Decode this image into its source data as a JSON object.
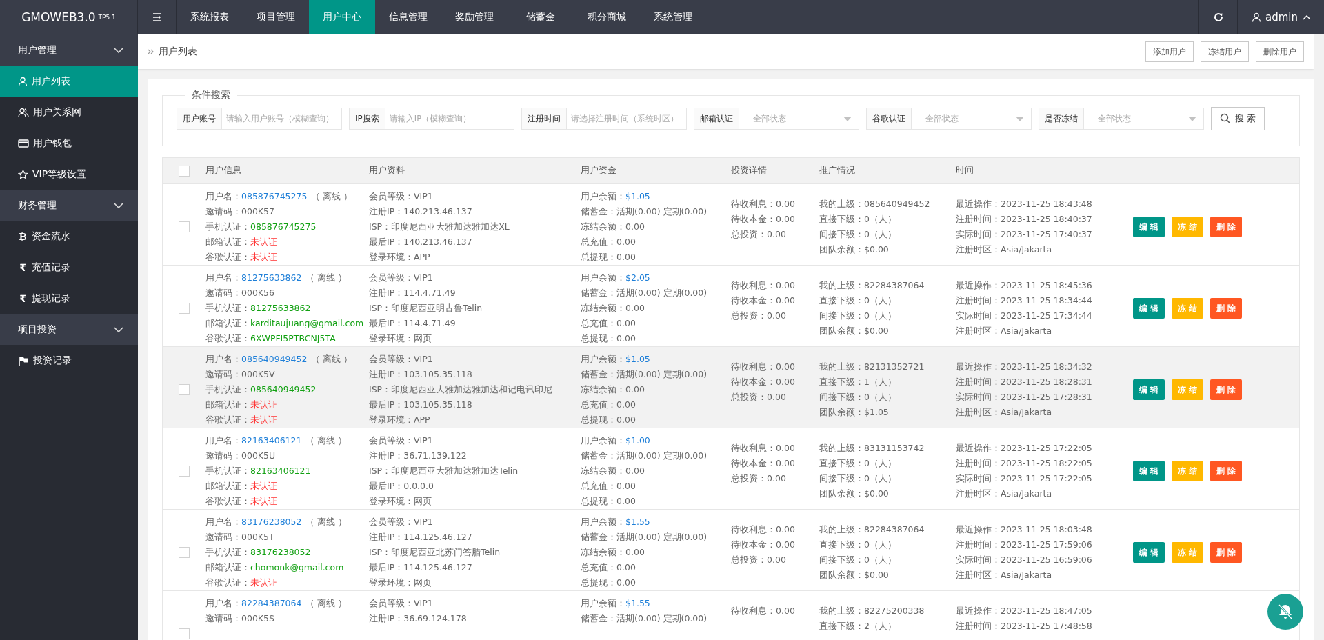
{
  "brand": {
    "name": "GMOWEB3.0",
    "version": "TP5.1"
  },
  "top_nav": [
    {
      "label": "系统报表",
      "selected": false
    },
    {
      "label": "项目管理",
      "selected": false
    },
    {
      "label": "用户中心",
      "selected": true
    },
    {
      "label": "信息管理",
      "selected": false
    },
    {
      "label": "奖励管理",
      "selected": false
    },
    {
      "label": "储蓄金",
      "selected": false
    },
    {
      "label": "积分商城",
      "selected": false
    },
    {
      "label": "系统管理",
      "selected": false
    }
  ],
  "user_menu": {
    "label": "admin",
    "expanded": true
  },
  "sidebar": [
    {
      "label": "用户管理",
      "expanded": true,
      "children": [
        {
          "label": "用户列表",
          "selected": true
        },
        {
          "label": "用户关系网",
          "selected": false
        },
        {
          "label": "用户钱包",
          "selected": false
        },
        {
          "label": "VIP等级设置",
          "selected": false
        }
      ]
    },
    {
      "label": "财务管理",
      "expanded": true,
      "children": [
        {
          "label": "资金流水",
          "selected": false,
          "glyph": "₿"
        },
        {
          "label": "充值记录",
          "selected": false,
          "glyph": "₹"
        },
        {
          "label": "提现记录",
          "selected": false,
          "glyph": "₹"
        }
      ]
    },
    {
      "label": "项目投资",
      "expanded": true,
      "children": [
        {
          "label": "投资记录",
          "selected": false
        }
      ]
    }
  ],
  "breadcrumb": "用户列表",
  "header_buttons": [
    "添加用户",
    "冻结用户",
    "删除用户"
  ],
  "search": {
    "legend": "条件搜索",
    "filters": [
      {
        "label": "用户账号",
        "kind": "input",
        "placeholder": "请输入用户账号（模糊查询）"
      },
      {
        "label": "IP搜索",
        "kind": "input",
        "placeholder": "请输入IP（模糊查询）"
      },
      {
        "label": "注册时间",
        "kind": "input",
        "placeholder": "请选择注册时间（系统时区）"
      },
      {
        "label": "邮箱认证",
        "kind": "select",
        "placeholder": "-- 全部状态 --"
      },
      {
        "label": "谷歌认证",
        "kind": "select",
        "placeholder": "-- 全部状态 --"
      },
      {
        "label": "是否冻结",
        "kind": "select",
        "placeholder": "-- 全部状态 --"
      }
    ],
    "button": "搜 索"
  },
  "table": {
    "select_all": false,
    "columns": [
      "用户信息",
      "用户资料",
      "用户资金",
      "投资详情",
      "推广情况",
      "时间"
    ],
    "rows": [
      {
        "selected": false,
        "highlighted": false,
        "cells": [
          [
            {
              "label": "用户名：",
              "value": "085876745275",
              "color": "#1e7fd8",
              "suffix": "（ 离线 ）"
            },
            {
              "label": "邀请码：",
              "value": "000K57"
            },
            {
              "label": "手机认证：",
              "value": "085876745275",
              "color": "#12a012"
            },
            {
              "label": "邮箱认证：",
              "value": "未认证",
              "color": "#ff3333"
            },
            {
              "label": "谷歌认证：",
              "value": "未认证",
              "color": "#ff3333"
            }
          ],
          [
            {
              "label": "会员等级：",
              "value": "VIP1"
            },
            {
              "label": "注册IP：",
              "value": "140.213.46.137"
            },
            {
              "label": "ISP：",
              "value": "印度尼西亚大雅加达雅加达XL"
            },
            {
              "label": "最后IP：",
              "value": "140.213.46.137"
            },
            {
              "label": "登录环境：",
              "value": "APP"
            }
          ],
          [
            {
              "label": "用户余额：",
              "value": "$1.05",
              "color": "#1e7fd8"
            },
            {
              "label": "储蓄金：",
              "value": "活期(0.00) 定期(0.00)"
            },
            {
              "label": "冻结余额：",
              "value": "0.00"
            },
            {
              "label": "总充值：",
              "value": "0.00"
            },
            {
              "label": "总提现：",
              "value": "0.00"
            }
          ],
          [
            {
              "label": "待收利息：",
              "value": "0.00"
            },
            {
              "label": "待收本金：",
              "value": "0.00"
            },
            {
              "label": "总投资：",
              "value": "0.00"
            }
          ],
          [
            {
              "label": "我的上级：",
              "value": "085640949452"
            },
            {
              "label": "直接下级：",
              "value": "0（人）"
            },
            {
              "label": "间接下级：",
              "value": "0（人）"
            },
            {
              "label": "团队余额：",
              "value": "$0.00"
            }
          ],
          [
            {
              "label": "最近操作：",
              "value": "2023-11-25 18:43:48"
            },
            {
              "label": "注册时间：",
              "value": "2023-11-25 18:40:37"
            },
            {
              "label": "实际时间：",
              "value": "2023-11-25 17:40:37"
            },
            {
              "label": "注册时区：",
              "value": "Asia/Jakarta"
            }
          ]
        ],
        "actions": [
          {
            "label": "编 辑",
            "kind": "edit"
          },
          {
            "label": "冻 结",
            "kind": "freeze"
          },
          {
            "label": "删 除",
            "kind": "delete"
          }
        ]
      },
      {
        "selected": false,
        "highlighted": false,
        "cells": [
          [
            {
              "label": "用户名：",
              "value": "81275633862",
              "color": "#1e7fd8",
              "suffix": "（ 离线 ）"
            },
            {
              "label": "邀请码：",
              "value": "000K56"
            },
            {
              "label": "手机认证：",
              "value": "81275633862",
              "color": "#12a012"
            },
            {
              "label": "邮箱认证：",
              "value": "karditaujuang@gmail.com",
              "color": "#12a012"
            },
            {
              "label": "谷歌认证：",
              "value": "6XWPFI5PTBCNJ5TA",
              "color": "#12a012"
            }
          ],
          [
            {
              "label": "会员等级：",
              "value": "VIP1"
            },
            {
              "label": "注册IP：",
              "value": "114.4.71.49"
            },
            {
              "label": "ISP：",
              "value": "印度尼西亚明古鲁Telin"
            },
            {
              "label": "最后IP：",
              "value": "114.4.71.49"
            },
            {
              "label": "登录环境：",
              "value": "网页"
            }
          ],
          [
            {
              "label": "用户余额：",
              "value": "$2.05",
              "color": "#1e7fd8"
            },
            {
              "label": "储蓄金：",
              "value": "活期(0.00) 定期(0.00)"
            },
            {
              "label": "冻结余额：",
              "value": "0.00"
            },
            {
              "label": "总充值：",
              "value": "0.00"
            },
            {
              "label": "总提现：",
              "value": "0.00"
            }
          ],
          [
            {
              "label": "待收利息：",
              "value": "0.00"
            },
            {
              "label": "待收本金：",
              "value": "0.00"
            },
            {
              "label": "总投资：",
              "value": "0.00"
            }
          ],
          [
            {
              "label": "我的上级：",
              "value": "82284387064"
            },
            {
              "label": "直接下级：",
              "value": "0（人）"
            },
            {
              "label": "间接下级：",
              "value": "0（人）"
            },
            {
              "label": "团队余额：",
              "value": "$0.00"
            }
          ],
          [
            {
              "label": "最近操作：",
              "value": "2023-11-25 18:45:36"
            },
            {
              "label": "注册时间：",
              "value": "2023-11-25 18:34:44"
            },
            {
              "label": "实际时间：",
              "value": "2023-11-25 17:34:44"
            },
            {
              "label": "注册时区：",
              "value": "Asia/Jakarta"
            }
          ]
        ],
        "actions": [
          {
            "label": "编 辑",
            "kind": "edit"
          },
          {
            "label": "冻 结",
            "kind": "freeze"
          },
          {
            "label": "删 除",
            "kind": "delete"
          }
        ]
      },
      {
        "selected": false,
        "highlighted": true,
        "cells": [
          [
            {
              "label": "用户名：",
              "value": "085640949452",
              "color": "#1e7fd8",
              "suffix": "（ 离线 ）"
            },
            {
              "label": "邀请码：",
              "value": "000K5V"
            },
            {
              "label": "手机认证：",
              "value": "085640949452",
              "color": "#12a012"
            },
            {
              "label": "邮箱认证：",
              "value": "未认证",
              "color": "#ff3333"
            },
            {
              "label": "谷歌认证：",
              "value": "未认证",
              "color": "#ff3333"
            }
          ],
          [
            {
              "label": "会员等级：",
              "value": "VIP1"
            },
            {
              "label": "注册IP：",
              "value": "103.105.35.118"
            },
            {
              "label": "ISP：",
              "value": "印度尼西亚大雅加达雅加达和记电讯印尼"
            },
            {
              "label": "最后IP：",
              "value": "103.105.35.118"
            },
            {
              "label": "登录环境：",
              "value": "APP"
            }
          ],
          [
            {
              "label": "用户余额：",
              "value": "$1.05",
              "color": "#1e7fd8"
            },
            {
              "label": "储蓄金：",
              "value": "活期(0.00) 定期(0.00)"
            },
            {
              "label": "冻结余额：",
              "value": "0.00"
            },
            {
              "label": "总充值：",
              "value": "0.00"
            },
            {
              "label": "总提现：",
              "value": "0.00"
            }
          ],
          [
            {
              "label": "待收利息：",
              "value": "0.00"
            },
            {
              "label": "待收本金：",
              "value": "0.00"
            },
            {
              "label": "总投资：",
              "value": "0.00"
            }
          ],
          [
            {
              "label": "我的上级：",
              "value": "82131352721"
            },
            {
              "label": "直接下级：",
              "value": "1（人）"
            },
            {
              "label": "间接下级：",
              "value": "0（人）"
            },
            {
              "label": "团队余额：",
              "value": "$1.05"
            }
          ],
          [
            {
              "label": "最近操作：",
              "value": "2023-11-25 18:34:32"
            },
            {
              "label": "注册时间：",
              "value": "2023-11-25 18:28:31"
            },
            {
              "label": "实际时间：",
              "value": "2023-11-25 17:28:31"
            },
            {
              "label": "注册时区：",
              "value": "Asia/Jakarta"
            }
          ]
        ],
        "actions": [
          {
            "label": "编 辑",
            "kind": "edit"
          },
          {
            "label": "冻 结",
            "kind": "freeze"
          },
          {
            "label": "删 除",
            "kind": "delete"
          }
        ]
      },
      {
        "selected": false,
        "highlighted": false,
        "cells": [
          [
            {
              "label": "用户名：",
              "value": "82163406121",
              "color": "#1e7fd8",
              "suffix": "（ 离线 ）"
            },
            {
              "label": "邀请码：",
              "value": "000K5U"
            },
            {
              "label": "手机认证：",
              "value": "82163406121",
              "color": "#12a012"
            },
            {
              "label": "邮箱认证：",
              "value": "未认证",
              "color": "#ff3333"
            },
            {
              "label": "谷歌认证：",
              "value": "未认证",
              "color": "#ff3333"
            }
          ],
          [
            {
              "label": "会员等级：",
              "value": "VIP1"
            },
            {
              "label": "注册IP：",
              "value": "36.71.139.122"
            },
            {
              "label": "ISP：",
              "value": "印度尼西亚大雅加达雅加达Telin"
            },
            {
              "label": "最后IP：",
              "value": "0.0.0.0"
            },
            {
              "label": "登录环境：",
              "value": "网页"
            }
          ],
          [
            {
              "label": "用户余额：",
              "value": "$1.00",
              "color": "#1e7fd8"
            },
            {
              "label": "储蓄金：",
              "value": "活期(0.00) 定期(0.00)"
            },
            {
              "label": "冻结余额：",
              "value": "0.00"
            },
            {
              "label": "总充值：",
              "value": "0.00"
            },
            {
              "label": "总提现：",
              "value": "0.00"
            }
          ],
          [
            {
              "label": "待收利息：",
              "value": "0.00"
            },
            {
              "label": "待收本金：",
              "value": "0.00"
            },
            {
              "label": "总投资：",
              "value": "0.00"
            }
          ],
          [
            {
              "label": "我的上级：",
              "value": "83131153742"
            },
            {
              "label": "直接下级：",
              "value": "0（人）"
            },
            {
              "label": "间接下级：",
              "value": "0（人）"
            },
            {
              "label": "团队余额：",
              "value": "$0.00"
            }
          ],
          [
            {
              "label": "最近操作：",
              "value": "2023-11-25 17:22:05"
            },
            {
              "label": "注册时间：",
              "value": "2023-11-25 18:22:05"
            },
            {
              "label": "实际时间：",
              "value": "2023-11-25 17:22:05"
            },
            {
              "label": "注册时区：",
              "value": "Asia/Jakarta"
            }
          ]
        ],
        "actions": [
          {
            "label": "编 辑",
            "kind": "edit"
          },
          {
            "label": "冻 结",
            "kind": "freeze"
          },
          {
            "label": "删 除",
            "kind": "delete"
          }
        ]
      },
      {
        "selected": false,
        "highlighted": false,
        "cells": [
          [
            {
              "label": "用户名：",
              "value": "83176238052",
              "color": "#1e7fd8",
              "suffix": "（ 离线 ）"
            },
            {
              "label": "邀请码：",
              "value": "000K5T"
            },
            {
              "label": "手机认证：",
              "value": "83176238052",
              "color": "#12a012"
            },
            {
              "label": "邮箱认证：",
              "value": "chomonk@gmail.com",
              "color": "#12a012"
            },
            {
              "label": "谷歌认证：",
              "value": "未认证",
              "color": "#ff3333"
            }
          ],
          [
            {
              "label": "会员等级：",
              "value": "VIP1"
            },
            {
              "label": "注册IP：",
              "value": "114.125.46.127"
            },
            {
              "label": "ISP：",
              "value": "印度尼西亚北苏门答腊Telin"
            },
            {
              "label": "最后IP：",
              "value": "114.125.46.127"
            },
            {
              "label": "登录环境：",
              "value": "网页"
            }
          ],
          [
            {
              "label": "用户余额：",
              "value": "$1.55",
              "color": "#1e7fd8"
            },
            {
              "label": "储蓄金：",
              "value": "活期(0.00) 定期(0.00)"
            },
            {
              "label": "冻结余额：",
              "value": "0.00"
            },
            {
              "label": "总充值：",
              "value": "0.00"
            },
            {
              "label": "总提现：",
              "value": "0.00"
            }
          ],
          [
            {
              "label": "待收利息：",
              "value": "0.00"
            },
            {
              "label": "待收本金：",
              "value": "0.00"
            },
            {
              "label": "总投资：",
              "value": "0.00"
            }
          ],
          [
            {
              "label": "我的上级：",
              "value": "82284387064"
            },
            {
              "label": "直接下级：",
              "value": "0（人）"
            },
            {
              "label": "间接下级：",
              "value": "0（人）"
            },
            {
              "label": "团队余额：",
              "value": "$0.00"
            }
          ],
          [
            {
              "label": "最近操作：",
              "value": "2023-11-25 18:03:48"
            },
            {
              "label": "注册时间：",
              "value": "2023-11-25 17:59:06"
            },
            {
              "label": "实际时间：",
              "value": "2023-11-25 16:59:06"
            },
            {
              "label": "注册时区：",
              "value": "Asia/Jakarta"
            }
          ]
        ],
        "actions": [
          {
            "label": "编 辑",
            "kind": "edit"
          },
          {
            "label": "冻 结",
            "kind": "freeze"
          },
          {
            "label": "删 除",
            "kind": "delete"
          }
        ]
      },
      {
        "selected": false,
        "highlighted": false,
        "cells": [
          [
            {
              "label": "用户名：",
              "value": "82284387064",
              "color": "#1e7fd8",
              "suffix": "（ 离线 ）"
            },
            {
              "label": "邀请码：",
              "value": "000K5S"
            }
          ],
          [
            {
              "label": "会员等级：",
              "value": "VIP1"
            },
            {
              "label": "注册IP：",
              "value": "36.69.124.178"
            }
          ],
          [
            {
              "label": "用户余额：",
              "value": "$1.55",
              "color": "#1e7fd8"
            },
            {
              "label": "储蓄金：",
              "value": "活期(0.00) 定期(0.00)"
            }
          ],
          [
            {
              "label": "待收利息：",
              "value": "0.00"
            }
          ],
          [
            {
              "label": "我的上级：",
              "value": "82275200338"
            },
            {
              "label": "直接下级：",
              "value": "2（人）"
            }
          ],
          [
            {
              "label": "最近操作：",
              "value": "2023-11-25 18:47:05"
            },
            {
              "label": "注册时间：",
              "value": "2023-11-25 17:48:58"
            }
          ]
        ],
        "actions": []
      }
    ]
  }
}
